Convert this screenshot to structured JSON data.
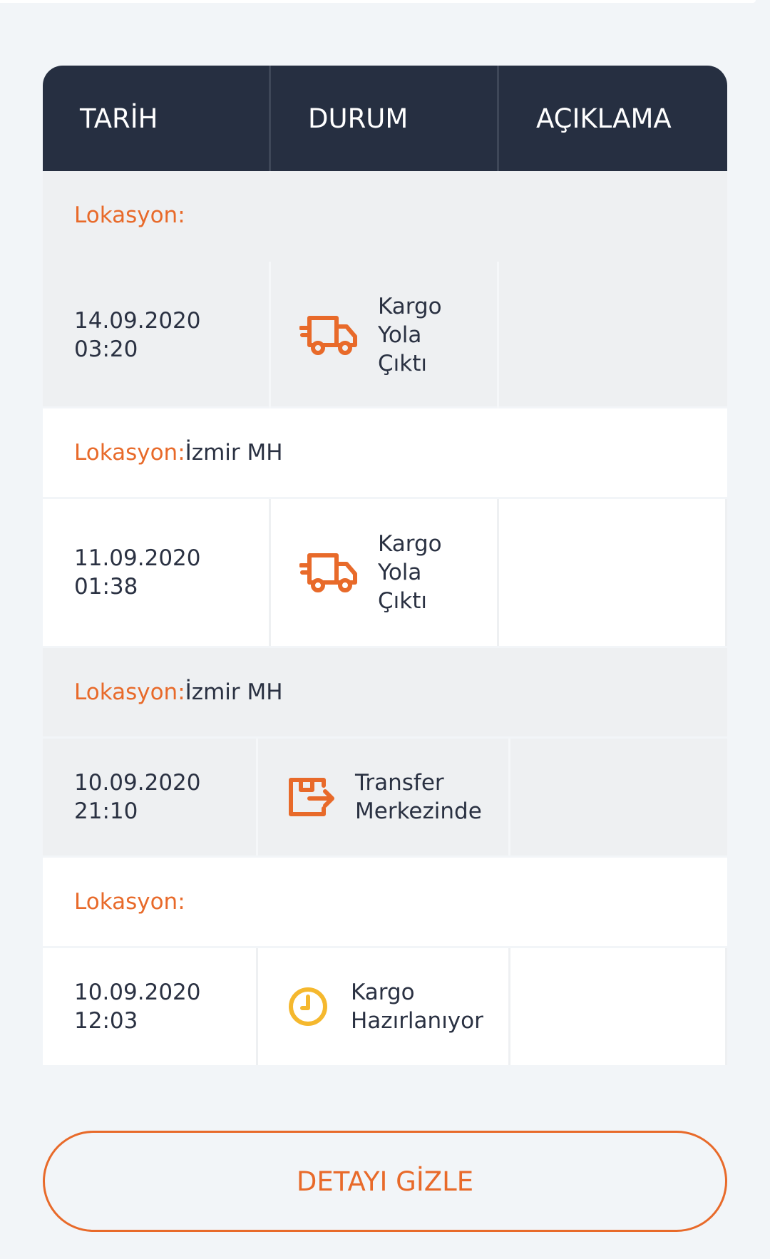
{
  "table": {
    "headers": [
      "TARİH",
      "DURUM",
      "AÇIKLAMA"
    ],
    "entries": [
      {
        "location_label": "Lokasyon:",
        "location_value": "",
        "date": "14.09.2020",
        "time": "03:20",
        "status_lines": [
          "Kargo",
          "Yola",
          "Çıktı"
        ],
        "status_icon": "truck-icon",
        "description": ""
      },
      {
        "location_label": "Lokasyon:",
        "location_value": "İzmir MH",
        "date": "11.09.2020",
        "time": "01:38",
        "status_lines": [
          "Kargo",
          "Yola",
          "Çıktı"
        ],
        "status_icon": "truck-icon",
        "description": ""
      },
      {
        "location_label": "Lokasyon:",
        "location_value": "İzmir MH",
        "date": "10.09.2020",
        "time": "21:10",
        "status_lines": [
          "Transfer",
          "Merkezinde"
        ],
        "status_icon": "transfer-box-icon",
        "description": ""
      },
      {
        "location_label": "Lokasyon:",
        "location_value": "",
        "date": "10.09.2020",
        "time": "12:03",
        "status_lines": [
          "Kargo",
          "Hazırlanıyor"
        ],
        "status_icon": "clock-icon",
        "description": ""
      }
    ]
  },
  "hide_details_button": {
    "label": "DETAYI GİZLE"
  },
  "colors": {
    "accent": "#e86a2a",
    "clock": "#f5b82e",
    "header_bg": "#262f41",
    "grey_row": "#eef0f2",
    "white_row": "#ffffff",
    "page_bg": "#f2f5f8"
  }
}
